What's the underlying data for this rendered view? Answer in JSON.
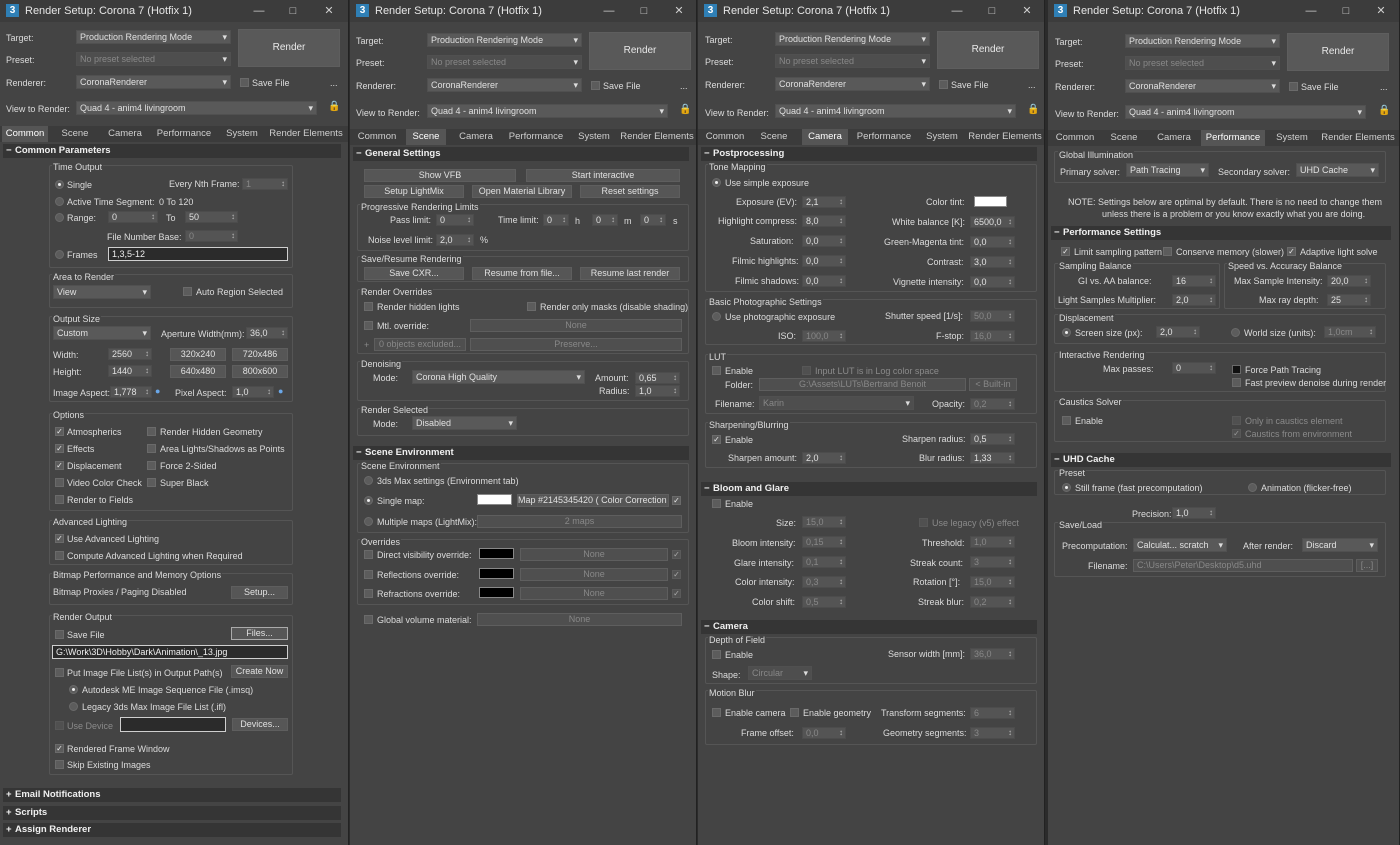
{
  "window_title": "Render Setup: Corona 7 (Hotfix 1)",
  "header": {
    "target_label": "Target:",
    "target_value": "Production Rendering Mode",
    "preset_label": "Preset:",
    "preset_value": "No preset selected",
    "renderer_label": "Renderer:",
    "renderer_value": "CoronaRenderer",
    "save_file": "Save File",
    "render_button": "Render",
    "view_label": "View to Render:",
    "view_value": "Quad 4 - anim4 livingroom",
    "more": "..."
  },
  "tabs": [
    "Common",
    "Scene",
    "Camera",
    "Performance",
    "System",
    "Render Elements"
  ],
  "common": {
    "rollout_title": "Common Parameters",
    "time_output": "Time Output",
    "single": "Single",
    "every_nth": "Every Nth Frame:",
    "every_nth_val": "1",
    "active_segment": "Active Time Segment:",
    "active_range": "0 To 120",
    "range": "Range:",
    "range_from": "0",
    "range_to_label": "To",
    "range_to": "50",
    "file_number_base": "File Number Base:",
    "file_number_val": "0",
    "frames": "Frames",
    "frames_val": "1,3,5-12",
    "area_to_render": "Area to Render",
    "area_val": "View",
    "auto_region": "Auto Region Selected",
    "output_size": "Output Size",
    "size_preset": "Custom",
    "aperture": "Aperture Width(mm):",
    "aperture_val": "36,0",
    "width_label": "Width:",
    "width_val": "2560",
    "height_label": "Height:",
    "height_val": "1440",
    "res1": "320x240",
    "res2": "720x486",
    "res3": "640x480",
    "res4": "800x600",
    "image_aspect": "Image Aspect:",
    "image_aspect_val": "1,778",
    "pixel_aspect": "Pixel Aspect:",
    "pixel_aspect_val": "1,0",
    "options": "Options",
    "opt_atmos": "Atmospherics",
    "opt_effects": "Effects",
    "opt_displacement": "Displacement",
    "opt_video": "Video Color Check",
    "opt_fields": "Render to Fields",
    "opt_hidden": "Render Hidden Geometry",
    "opt_area": "Area Lights/Shadows as Points",
    "opt_force": "Force 2-Sided",
    "opt_super": "Super Black",
    "adv_lighting": "Advanced Lighting",
    "use_adv": "Use Advanced Lighting",
    "compute_adv": "Compute Advanced Lighting when Required",
    "bitmap_perf": "Bitmap Performance and Memory Options",
    "bitmap_proxies": "Bitmap Proxies / Paging Disabled",
    "setup_btn": "Setup...",
    "render_output": "Render Output",
    "ro_save": "Save File",
    "files_btn": "Files...",
    "output_path": "G:\\Work\\3D\\Hobby\\Dark\\Animation\\_13.jpg",
    "put_image": "Put Image File List(s) in Output Path(s)",
    "create_now": "Create Now",
    "autodesk_seq": "Autodesk ME Image Sequence File (.imsq)",
    "legacy_seq": "Legacy 3ds Max Image File List (.ifl)",
    "use_device": "Use Device",
    "devices_btn": "Devices...",
    "rendered_frame": "Rendered Frame Window",
    "skip_existing": "Skip Existing Images",
    "email": "Email Notifications",
    "scripts": "Scripts",
    "assign": "Assign Renderer"
  },
  "scene": {
    "general": "General Settings",
    "show_vfb": "Show VFB",
    "start_interactive": "Start interactive",
    "setup_lightmix": "Setup LightMix",
    "open_material": "Open Material Library",
    "reset": "Reset settings",
    "prog_limits": "Progressive Rendering Limits",
    "pass_limit": "Pass limit:",
    "pass_val": "0",
    "time_limit": "Time limit:",
    "t_h": "0",
    "h": "h",
    "t_m": "0",
    "m": "m",
    "t_s": "0",
    "s": "s",
    "noise_limit": "Noise level limit:",
    "noise_val": "2,0",
    "pct": "%",
    "save_resume": "Save/Resume Rendering",
    "save_cxr": "Save CXR...",
    "resume_file": "Resume from file...",
    "resume_last": "Resume last render",
    "overrides": "Render Overrides",
    "render_hidden_lights": "Render hidden lights",
    "render_only_masks": "Render only masks (disable shading)",
    "mtl_override": "Mtl. override:",
    "none": "None",
    "objects_excluded": "0 objects excluded...",
    "preserve": "Preserve...",
    "denoising": "Denoising",
    "mode": "Mode:",
    "denoise_mode": "Corona High Quality",
    "amount": "Amount:",
    "amount_val": "0,65",
    "radius": "Radius:",
    "radius_val": "1,0",
    "render_selected": "Render Selected",
    "rs_mode": "Disabled",
    "scene_env": "Scene Environment",
    "scene_env_grp": "Scene Environment",
    "max_settings": "3ds Max settings (Environment tab)",
    "single_map": "Single map:",
    "map_name": "Map #2145345420  ( Color Correction )",
    "multiple_maps": "Multiple maps (LightMix):",
    "maps2": "2 maps",
    "overrides2": "Overrides",
    "direct_vis": "Direct visibility override:",
    "refl_override": "Reflections override:",
    "refr_override": "Refractions override:",
    "global_volume": "Global volume material:"
  },
  "camera": {
    "postprocessing": "Postprocessing",
    "tone_mapping": "Tone Mapping",
    "use_simple": "Use simple exposure",
    "exposure": "Exposure (EV):",
    "exposure_val": "2,1",
    "highlight": "Highlight compress:",
    "highlight_val": "8,0",
    "saturation": "Saturation:",
    "saturation_val": "0,0",
    "filmic_hl": "Filmic highlights:",
    "filmic_hl_val": "0,0",
    "filmic_sh": "Filmic shadows:",
    "filmic_sh_val": "0,0",
    "color_tint": "Color tint:",
    "wb": "White balance [K]:",
    "wb_val": "6500,0",
    "gm_tint": "Green-Magenta tint:",
    "gm_val": "0,0",
    "contrast": "Contrast:",
    "contrast_val": "3,0",
    "vignette": "Vignette intensity:",
    "vignette_val": "0,0",
    "basic_photo": "Basic Photographic Settings",
    "use_photo": "Use photographic exposure",
    "shutter": "Shutter speed [1/s]:",
    "shutter_val": "50,0",
    "iso": "ISO:",
    "iso_val": "100,0",
    "fstop": "F-stop:",
    "fstop_val": "16,0",
    "lut": "LUT",
    "lut_enable": "Enable",
    "lut_log": "Input LUT is in Log color space",
    "folder": "Folder:",
    "folder_val": "G:\\Assets\\LUTs\\Bertrand Benoit",
    "builtin": "< Built-in",
    "filename": "Filename:",
    "filename_val": "Karin",
    "opacity": "Opacity:",
    "opacity_val": "0,2",
    "sharpen": "Sharpening/Blurring",
    "sharp_enable": "Enable",
    "sharp_amount": "Sharpen amount:",
    "sharp_amount_val": "2,0",
    "sharp_radius": "Sharpen radius:",
    "sharp_radius_val": "0,5",
    "blur_radius": "Blur radius:",
    "blur_radius_val": "1,33",
    "bloom": "Bloom and Glare",
    "bloom_enable": "Enable",
    "size": "Size:",
    "size_val": "15,0",
    "use_legacy": "Use legacy (v5) effect",
    "bloom_int": "Bloom intensity:",
    "bloom_int_val": "0,15",
    "threshold": "Threshold:",
    "threshold_val": "1,0",
    "glare_int": "Glare intensity:",
    "glare_int_val": "0,1",
    "streak_count": "Streak count:",
    "streak_count_val": "3",
    "color_int": "Color intensity:",
    "color_int_val": "0,3",
    "rotation": "Rotation [°]:",
    "rotation_val": "15,0",
    "color_shift": "Color shift:",
    "color_shift_val": "0,5",
    "streak_blur": "Streak blur:",
    "streak_blur_val": "0,2",
    "camera_roll": "Camera",
    "dof": "Depth of Field",
    "dof_enable": "Enable",
    "sensor": "Sensor width [mm]:",
    "sensor_val": "36,0",
    "shape": "Shape:",
    "shape_val": "Circular",
    "motion_blur": "Motion Blur",
    "enable_camera": "Enable camera",
    "enable_geometry": "Enable geometry",
    "transform_seg": "Transform segments:",
    "transform_val": "6",
    "frame_offset": "Frame offset:",
    "frame_offset_val": "0,0",
    "geometry_seg": "Geometry segments:",
    "geometry_val": "3"
  },
  "performance": {
    "gi": "Global Illumination",
    "primary": "Primary solver:",
    "primary_val": "Path Tracing",
    "secondary": "Secondary solver:",
    "secondary_val": "UHD Cache",
    "note1": "NOTE: Settings below are optimal by default. There is no need to change them",
    "note2": "unless there is a problem or you know exactly what you are doing.",
    "perf_settings": "Performance Settings",
    "limit_sampling": "Limit sampling pattern",
    "conserve_memory": "Conserve memory (slower)",
    "adaptive_light": "Adaptive light solve",
    "sampling_balance": "Sampling Balance",
    "gi_aa": "GI vs. AA balance:",
    "gi_aa_val": "16",
    "light_mult": "Light Samples Multiplier:",
    "light_mult_val": "2,0",
    "speed_accuracy": "Speed vs. Accuracy Balance",
    "max_sample": "Max Sample Intensity:",
    "max_sample_val": "20,0",
    "max_ray": "Max ray depth:",
    "max_ray_val": "25",
    "displacement": "Displacement",
    "screen_size": "Screen size (px):",
    "screen_size_val": "2,0",
    "world_size": "World size (units):",
    "world_size_val": "1,0cm",
    "interactive": "Interactive Rendering",
    "max_passes": "Max passes:",
    "max_passes_val": "0",
    "force_pt": "Force Path Tracing",
    "fast_preview": "Fast preview denoise during render",
    "caustics": "Caustics Solver",
    "caustics_enable": "Enable",
    "only_caustics": "Only in caustics element",
    "caustics_env": "Caustics from environment",
    "uhd": "UHD Cache",
    "preset": "Preset",
    "still_frame": "Still frame (fast precomputation)",
    "animation": "Animation (flicker-free)",
    "precision": "Precision:",
    "precision_val": "1,0",
    "save_load": "Save/Load",
    "precomputation": "Precomputation:",
    "precomp_val": "Calculat... scratch",
    "after_render": "After render:",
    "after_render_val": "Discard",
    "uhd_filename": "Filename:",
    "uhd_filename_val": "C:\\Users\\Peter\\Desktop\\d5.uhd",
    "browse": "[...]"
  }
}
